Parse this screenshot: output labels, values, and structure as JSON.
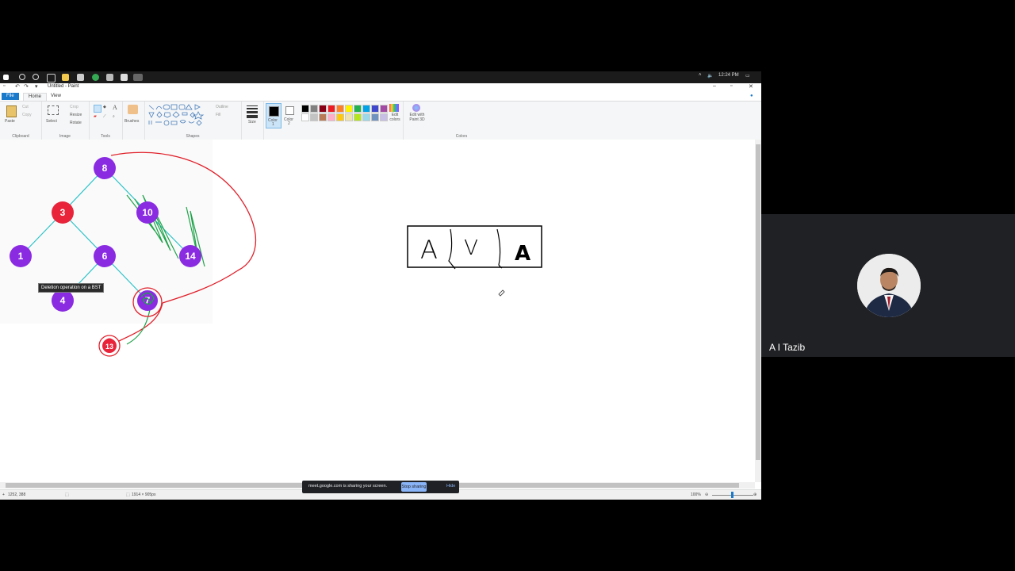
{
  "taskbar": {
    "time": "12:24 PM",
    "icons": [
      "windows-icon",
      "search-icon",
      "cortana-icon",
      "task-view-icon",
      "file-explorer-icon",
      "store-icon",
      "chrome-icon",
      "edge-icon",
      "snip-icon",
      "paint-icon"
    ]
  },
  "window": {
    "title": "Untitled - Paint",
    "menu_tabs": [
      "File",
      "Home",
      "View"
    ]
  },
  "ribbon": {
    "clipboard": {
      "paste": "Paste",
      "cut": "Cut",
      "copy": "Copy",
      "label": "Clipboard"
    },
    "image": {
      "select": "Select",
      "crop": "Crop",
      "resize": "Resize",
      "rotate": "Rotate",
      "label": "Image"
    },
    "tools": {
      "label": "Tools"
    },
    "brushes": {
      "label": "Brushes"
    },
    "shapes": {
      "outline": "Outline",
      "fill": "Fill",
      "label": "Shapes"
    },
    "size": {
      "label": "Size"
    },
    "color1": {
      "label1": "Color",
      "label2": "1"
    },
    "color2": {
      "label1": "Color",
      "label2": "2"
    },
    "colors": {
      "label": "Colors",
      "edit": "Edit colors"
    },
    "paint3d": {
      "label": "Edit with Paint 3D"
    },
    "palette": [
      "#000000",
      "#7f7f7f",
      "#880015",
      "#ed1c24",
      "#ff7f27",
      "#fff200",
      "#22b14c",
      "#00a2e8",
      "#3f48cc",
      "#a349a4",
      "#ffffff",
      "#c3c3c3",
      "#b97a57",
      "#ffaec9",
      "#ffc90e",
      "#efe4b0",
      "#b5e61d",
      "#99d9ea",
      "#7092be",
      "#c8bfe7"
    ]
  },
  "canvas": {
    "tooltip": "Deletion operation on a BST",
    "nodes": [
      "8",
      "3",
      "10",
      "1",
      "6",
      "14",
      "4",
      "7",
      "13"
    ],
    "box_letters": [
      "A",
      "V",
      "A"
    ]
  },
  "statusbar": {
    "cursor_pos": "1252, 388",
    "image_size": "1914 × 905px",
    "zoom": "100%"
  },
  "share_banner": {
    "message": "meet.google.com is sharing your screen.",
    "stop": "Stop sharing",
    "hide": "Hide"
  },
  "participant": {
    "name": "A I Tazib"
  }
}
